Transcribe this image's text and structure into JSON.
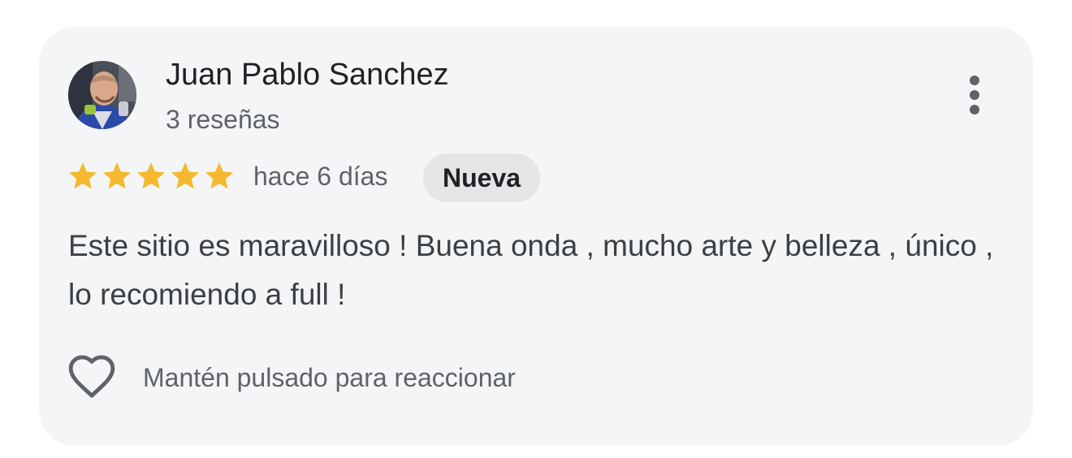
{
  "review": {
    "author": {
      "name": "Juan Pablo Sanchez",
      "reviews_count": "3 reseñas"
    },
    "rating": 5,
    "rating_max": 5,
    "date": "hace 6 días",
    "badge": "Nueva",
    "text": "Este sitio es maravilloso ! Buena onda , mucho arte y belleza , único , lo recomiendo a full !",
    "reaction_hint": "Mantén pulsado para reaccionar"
  },
  "icons": {
    "more": "more-vert-icon",
    "star": "star-icon",
    "heart": "heart-outline-icon"
  },
  "colors": {
    "card_background": "#f4f5f7",
    "star": "#f5b82e",
    "badge_background": "#e4e5e7",
    "primary_text": "#202124",
    "secondary_text": "#5f6368"
  }
}
